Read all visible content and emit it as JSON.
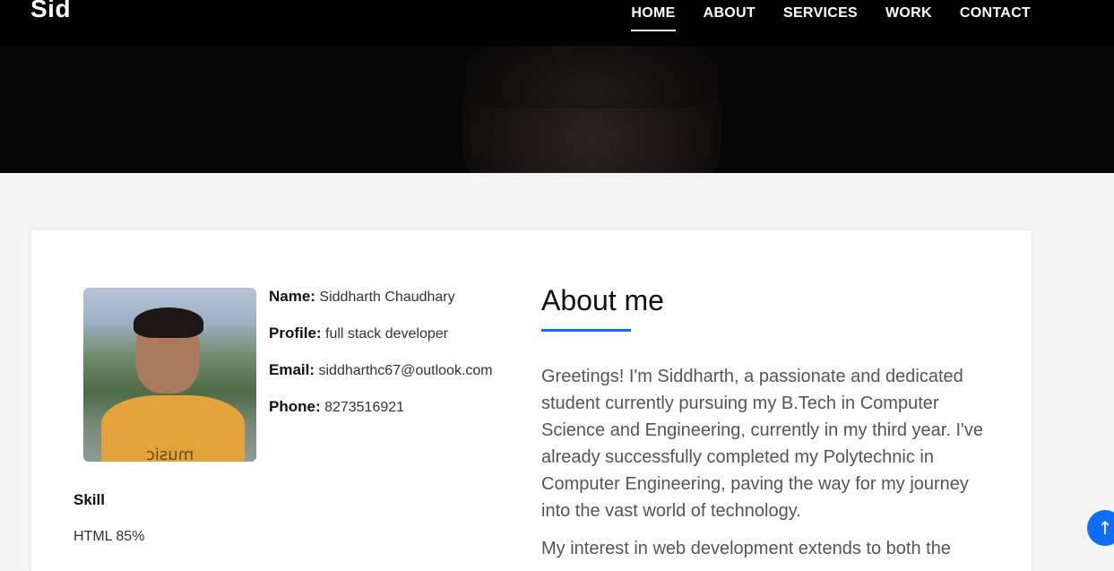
{
  "brand": "Sid",
  "nav": {
    "items": [
      {
        "label": "HOME"
      },
      {
        "label": "ABOUT"
      },
      {
        "label": "SERVICES"
      },
      {
        "label": "WORK"
      },
      {
        "label": "CONTACT"
      }
    ],
    "active": "HOME"
  },
  "profile": {
    "name_label": "Name:",
    "name": "Siddharth Chaudhary",
    "profile_label": "Profile:",
    "profile": "full stack developer",
    "email_label": "Email:",
    "email": "siddharthc67@outlook.com",
    "phone_label": "Phone:",
    "phone": "8273516921",
    "photo_shirt_text": "music"
  },
  "skills": {
    "title": "Skill",
    "items": [
      {
        "label": "HTML 85%"
      }
    ]
  },
  "about": {
    "title": "About me",
    "paragraph1": "Greetings! I'm Siddharth, a passionate and dedicated student currently pursuing my B.Tech in Computer Science and Engineering, currently in my third year. I've already successfully completed my Polytechnic in Computer Engineering, paving the way for my journey into the vast world of technology.",
    "paragraph2": "My interest in web development extends to both the"
  },
  "scroll_top": {
    "icon": "arrow-up-icon",
    "glyph": "↑"
  },
  "colors": {
    "accent": "#0d6efd",
    "navbar": "#000000"
  }
}
